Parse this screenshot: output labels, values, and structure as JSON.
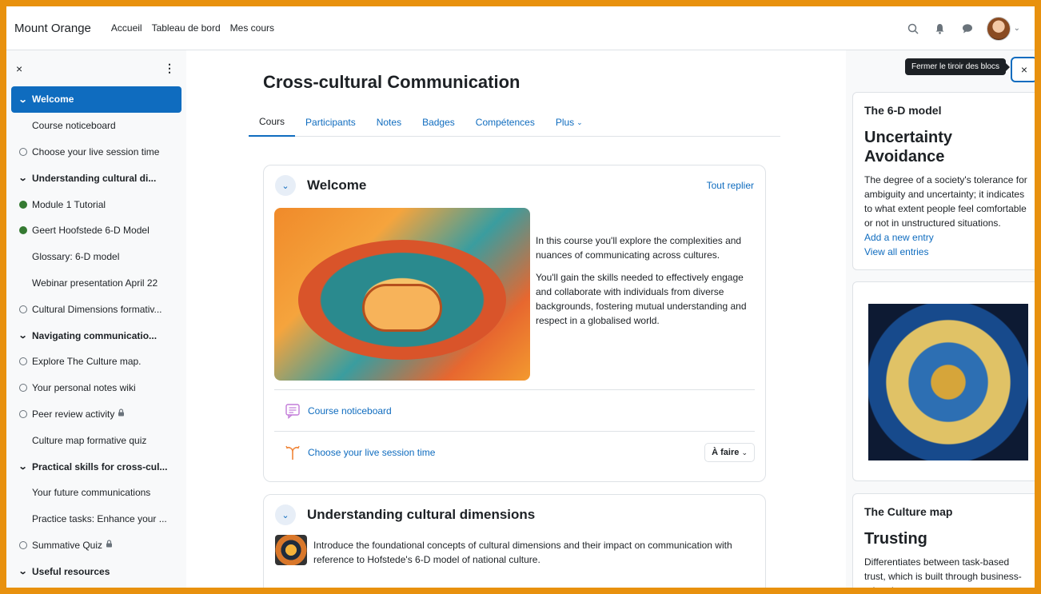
{
  "navbar": {
    "brand": "Mount Orange",
    "links": [
      "Accueil",
      "Tableau de bord",
      "Mes cours"
    ]
  },
  "left": {
    "close": "×",
    "menu": "⋮",
    "items": [
      {
        "label": "Welcome",
        "kind": "section-active"
      },
      {
        "label": "Course noticeboard",
        "kind": "plain"
      },
      {
        "label": "Choose your live session time",
        "kind": "circle"
      },
      {
        "label": "Understanding cultural di...",
        "kind": "section"
      },
      {
        "label": "Module 1 Tutorial",
        "kind": "done"
      },
      {
        "label": "Geert Hoofstede 6-D Model",
        "kind": "done"
      },
      {
        "label": "Glossary: 6-D model",
        "kind": "plain"
      },
      {
        "label": "Webinar presentation April 22",
        "kind": "plain"
      },
      {
        "label": "Cultural Dimensions formativ...",
        "kind": "circle"
      },
      {
        "label": "Navigating communicatio...",
        "kind": "section"
      },
      {
        "label": "Explore The Culture map.",
        "kind": "circle"
      },
      {
        "label": "Your personal notes wiki",
        "kind": "circle"
      },
      {
        "label": "Peer review activity",
        "kind": "circle-lock"
      },
      {
        "label": "Culture map formative quiz",
        "kind": "plain"
      },
      {
        "label": "Practical skills for cross-cul...",
        "kind": "section"
      },
      {
        "label": "Your future communications",
        "kind": "plain"
      },
      {
        "label": "Practice tasks: Enhance your ...",
        "kind": "plain"
      },
      {
        "label": "Summative Quiz",
        "kind": "circle-lock"
      },
      {
        "label": "Useful resources",
        "kind": "section"
      }
    ]
  },
  "main": {
    "title": "Cross-cultural Communication",
    "tabs": [
      "Cours",
      "Participants",
      "Notes",
      "Badges",
      "Compétences",
      "Plus"
    ],
    "welcome": {
      "title": "Welcome",
      "collapse_all": "Tout replier",
      "para1": "In this course you'll explore the complexities and nuances of communicating across cultures.",
      "para2": "You'll gain the skills needed to effectively engage and collaborate with individuals from diverse backgrounds, fostering mutual understanding and respect in a globalised world.",
      "activity1": "Course noticeboard",
      "activity2": "Choose your live session time",
      "todo": "À faire"
    },
    "section2": {
      "title": "Understanding cultural dimensions",
      "text": "Introduce the foundational concepts of cultural dimensions and their impact on communication with reference to Hofstede's 6-D model of national culture."
    }
  },
  "right": {
    "tooltip": "Fermer le tiroir des blocs",
    "close": "×",
    "block1": {
      "title": "The 6-D model",
      "term": "Uncertainty Avoidance",
      "definition": "The degree of a society's tolerance for ambiguity and uncertainty; it indicates to what extent people feel comfortable or not in unstructured situations.",
      "add": "Add a new entry",
      "view": "View all entries"
    },
    "block3": {
      "title": "The Culture map",
      "term": "Trusting",
      "definition": "Differentiates between task-based trust, which is built through business-related"
    }
  },
  "colors": {
    "accent": "#0f6cbf",
    "frame": "#e8910e",
    "done": "#357a32"
  }
}
